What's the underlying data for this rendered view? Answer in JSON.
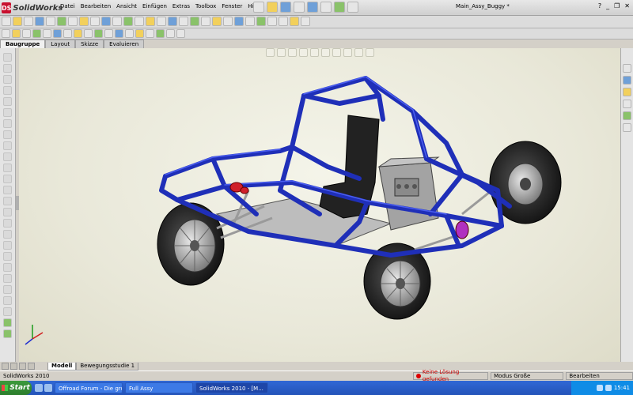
{
  "app": {
    "brand": "SolidWorks",
    "document_title": "Main_Assy_Buggy *",
    "window_controls": [
      "?",
      "_",
      "❐",
      "✕"
    ]
  },
  "menu": [
    "Datei",
    "Bearbeiten",
    "Ansicht",
    "Einfügen",
    "Extras",
    "Toolbox",
    "Fenster",
    "Hilfe"
  ],
  "command_tabs": [
    "Baugruppe",
    "Layout",
    "Skizze",
    "Evaluieren"
  ],
  "model_tabs": [
    "Modell",
    "Bewegungsstudie 1"
  ],
  "status": {
    "app_version": "SolidWorks 2010",
    "error": "Keine Lösung gefunden",
    "mode": "Modus Große Baugruppe",
    "editing": "Bearbeiten Baugruppe"
  },
  "taskbar": {
    "start": "Start",
    "tasks": [
      "Offroad Forum - Die gro...",
      "Full Assy",
      "SolidWorks 2010 - [M..."
    ],
    "clock": "15:41"
  },
  "colors": {
    "frame": "#1f2fb8",
    "frame_highlight": "#4a5ef0",
    "viewport_bg": "#ecebdc",
    "tire": "#1a1a1a",
    "seat": "#222222",
    "engine": "#9a9a9a",
    "accent_red": "#d0202a",
    "accent_magenta": "#b030c0"
  }
}
